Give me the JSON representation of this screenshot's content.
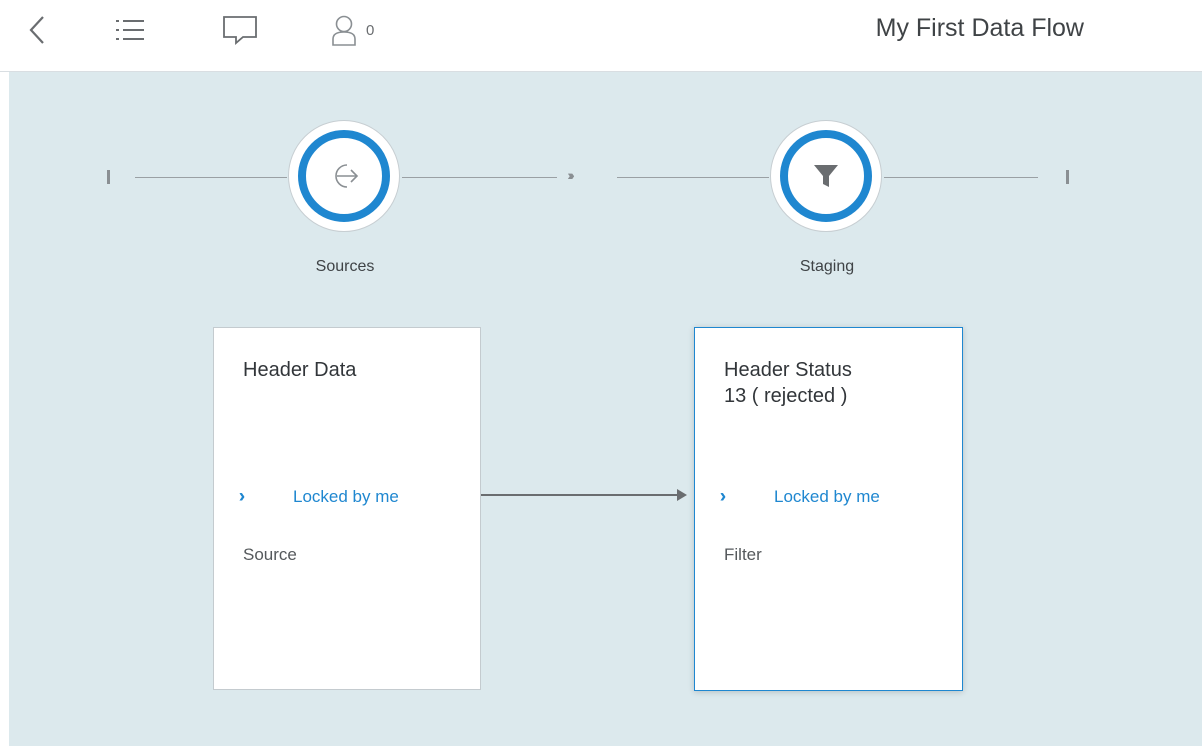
{
  "header": {
    "title": "My First Data Flow",
    "users_count": "0",
    "icons": [
      "chevron-left-icon",
      "list-icon",
      "comment-icon",
      "user-icon"
    ]
  },
  "colors": {
    "accent": "#1f87d0",
    "canvas_bg": "#dce9ed",
    "text": "#32363a"
  },
  "stages": [
    {
      "label": "Sources",
      "icon": "exit-icon"
    },
    {
      "label": "Staging",
      "icon": "filter-icon"
    }
  ],
  "cards": [
    {
      "title": "Header Data",
      "subtitle": "",
      "lock_status": "Locked by me",
      "type": "Source",
      "selected": false
    },
    {
      "title": "Header Status",
      "subtitle": "13 ( rejected )",
      "lock_status": "Locked by me",
      "type": "Filter",
      "selected": true
    }
  ]
}
